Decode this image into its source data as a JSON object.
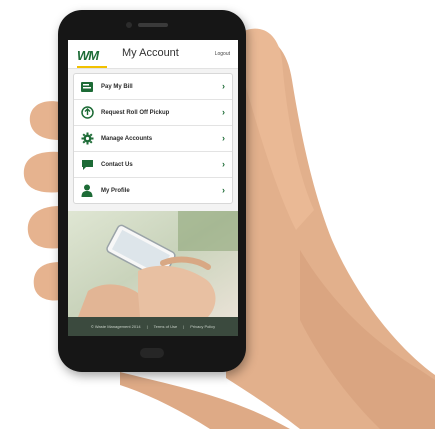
{
  "header": {
    "logo_text": "WM",
    "title": "My Account",
    "logout_label": "Logout"
  },
  "menu": {
    "items": [
      {
        "label": "Pay My Bill",
        "icon": "bill-icon"
      },
      {
        "label": "Request Roll Off Pickup",
        "icon": "pickup-icon"
      },
      {
        "label": "Manage Accounts",
        "icon": "gear-icon"
      },
      {
        "label": "Contact Us",
        "icon": "chat-icon"
      },
      {
        "label": "My Profile",
        "icon": "person-icon"
      }
    ]
  },
  "footer": {
    "copyright": "© Waste Management 2014",
    "terms": "Terms of Use",
    "privacy": "Privacy Policy"
  },
  "colors": {
    "brand_green": "#1d6b36",
    "brand_yellow": "#f2c100",
    "footer_bg": "#3b4a3e"
  }
}
